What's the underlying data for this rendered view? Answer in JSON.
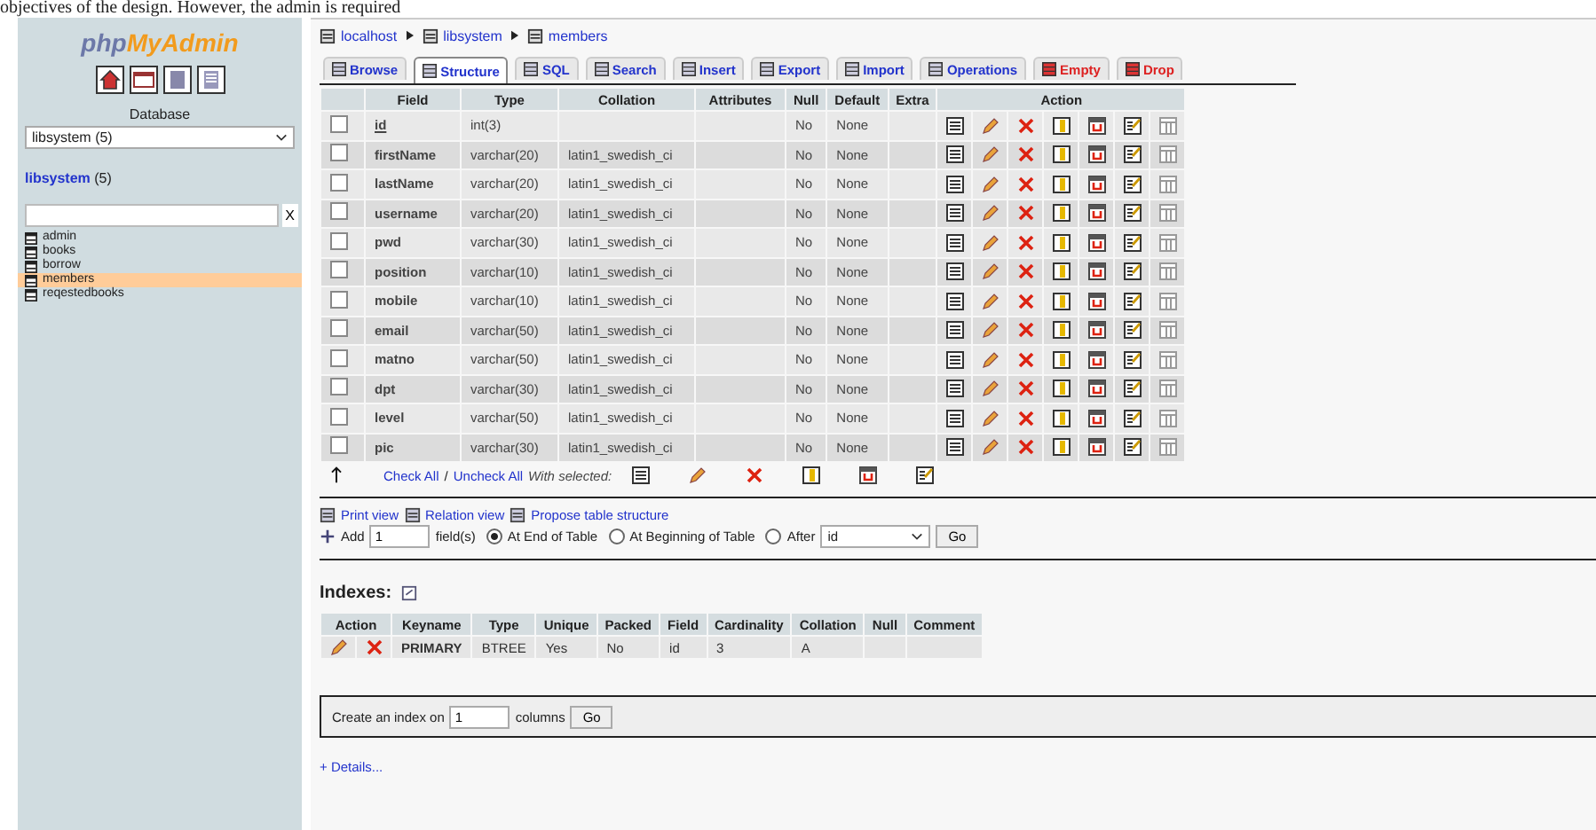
{
  "document_text": "objectives of the design. However, the admin is required",
  "sidebar": {
    "logo": {
      "prefix": "php",
      "name": "MyAdmin"
    },
    "database_label": "Database",
    "database_select": "libsystem (5)",
    "db_link": "libsystem",
    "db_count": "(5)",
    "filter_clear": "X",
    "tables": [
      {
        "name": "admin",
        "selected": false
      },
      {
        "name": "books",
        "selected": false
      },
      {
        "name": "borrow",
        "selected": false
      },
      {
        "name": "members",
        "selected": true
      },
      {
        "name": "reqestedbooks",
        "selected": false
      }
    ]
  },
  "breadcrumb": [
    "localhost",
    "libsystem",
    "members"
  ],
  "tabs": [
    {
      "label": "Browse",
      "selected": false,
      "kind": "normal"
    },
    {
      "label": "Structure",
      "selected": true,
      "kind": "normal"
    },
    {
      "label": "SQL",
      "selected": false,
      "kind": "normal"
    },
    {
      "label": "Search",
      "selected": false,
      "kind": "normal"
    },
    {
      "label": "Insert",
      "selected": false,
      "kind": "normal"
    },
    {
      "label": "Export",
      "selected": false,
      "kind": "normal"
    },
    {
      "label": "Import",
      "selected": false,
      "kind": "normal"
    },
    {
      "label": "Operations",
      "selected": false,
      "kind": "normal"
    },
    {
      "label": "Empty",
      "selected": false,
      "kind": "danger"
    },
    {
      "label": "Drop",
      "selected": false,
      "kind": "danger"
    }
  ],
  "fields": {
    "columns": [
      "Field",
      "Type",
      "Collation",
      "Attributes",
      "Null",
      "Default",
      "Extra",
      "Action"
    ],
    "rows": [
      {
        "field": "id",
        "type": "int(3)",
        "null": "No",
        "default": "None",
        "checked": false,
        "primary": true
      },
      {
        "field": "firstName",
        "type": "varchar(20)",
        "collation": "latin1_swedish_ci",
        "null": "No",
        "default": "None",
        "checked": false,
        "primary": false
      },
      {
        "field": "lastName",
        "type": "varchar(20)",
        "collation": "latin1_swedish_ci",
        "null": "No",
        "default": "None",
        "checked": false,
        "primary": false
      },
      {
        "field": "username",
        "type": "varchar(20)",
        "collation": "latin1_swedish_ci",
        "null": "No",
        "default": "None",
        "checked": false,
        "primary": false
      },
      {
        "field": "pwd",
        "type": "varchar(30)",
        "collation": "latin1_swedish_ci",
        "null": "No",
        "default": "None",
        "checked": false,
        "primary": false
      },
      {
        "field": "position",
        "type": "varchar(10)",
        "collation": "latin1_swedish_ci",
        "null": "No",
        "default": "None",
        "checked": false,
        "primary": false
      },
      {
        "field": "mobile",
        "type": "varchar(10)",
        "collation": "latin1_swedish_ci",
        "null": "No",
        "default": "None",
        "checked": false,
        "primary": false
      },
      {
        "field": "email",
        "type": "varchar(50)",
        "collation": "latin1_swedish_ci",
        "null": "No",
        "default": "None",
        "checked": false,
        "primary": false
      },
      {
        "field": "matno",
        "type": "varchar(50)",
        "collation": "latin1_swedish_ci",
        "null": "No",
        "default": "None",
        "checked": false,
        "primary": false
      },
      {
        "field": "dpt",
        "type": "varchar(30)",
        "collation": "latin1_swedish_ci",
        "null": "No",
        "default": "None",
        "checked": false,
        "primary": false
      },
      {
        "field": "level",
        "type": "varchar(50)",
        "collation": "latin1_swedish_ci",
        "null": "No",
        "default": "None",
        "checked": false,
        "primary": false
      },
      {
        "field": "pic",
        "type": "varchar(30)",
        "collation": "latin1_swedish_ci",
        "null": "No",
        "default": "None",
        "checked": false,
        "primary": false
      }
    ]
  },
  "with_selected": {
    "check_all": "Check All",
    "separator": "/",
    "uncheck_all": "Uncheck All",
    "label": "With selected:"
  },
  "links": [
    "Print view",
    "Relation view",
    "Propose table structure"
  ],
  "add_fields": {
    "add": "Add",
    "count": "1",
    "fields": "field(s)",
    "options": [
      {
        "label": "At End of Table",
        "selected": true
      },
      {
        "label": "At Beginning of Table",
        "selected": false
      },
      {
        "label": "After",
        "selected": false
      }
    ],
    "after_column": "id",
    "go": "Go"
  },
  "indexes": {
    "title": "Indexes:",
    "columns": [
      "Action",
      "Keyname",
      "Type",
      "Unique",
      "Packed",
      "Field",
      "Cardinality",
      "Collation",
      "Null",
      "Comment"
    ],
    "rows": [
      {
        "keyname": "PRIMARY",
        "type": "BTREE",
        "unique": "Yes",
        "packed": "No",
        "field": "id",
        "cardinality": "3",
        "collation": "A"
      }
    ]
  },
  "create_index": {
    "label": "Create an index on",
    "count": "1",
    "columns": "columns",
    "go": "Go"
  },
  "details": "+ Details..."
}
